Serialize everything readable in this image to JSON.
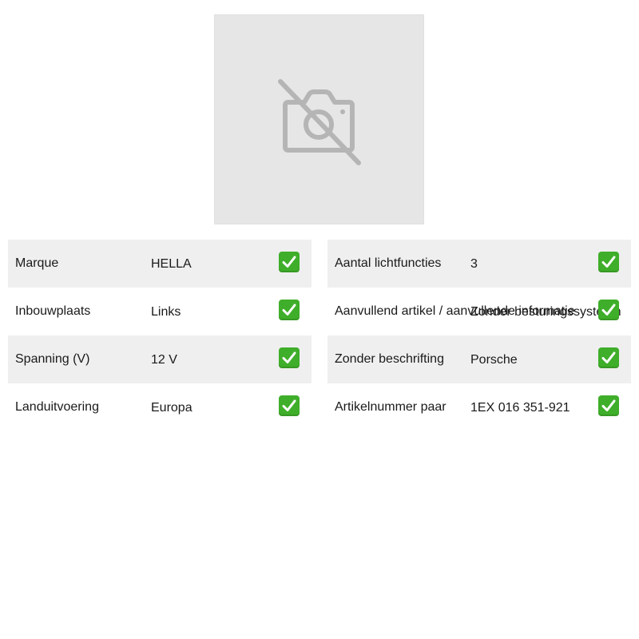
{
  "image": {
    "icon": "camera-off-icon",
    "placeholder_color": "#e6e6e6",
    "icon_color": "#b5b5b5"
  },
  "check_icon": "check-mark-icon",
  "check_color": "#3fae2a",
  "left_table": [
    {
      "label": "Marque",
      "value": "HELLA"
    },
    {
      "label": "Inbouwplaats",
      "value": "Links"
    },
    {
      "label": "Spanning (V)",
      "value": "12 V"
    },
    {
      "label": "Landuitvoering",
      "value": "Europa"
    }
  ],
  "right_table": [
    {
      "label": "Aantal lichtfuncties",
      "value": "3"
    },
    {
      "label": "Aanvullend artikel / aanvullende informatie",
      "value": "Zonder besturingssysteem"
    },
    {
      "label": "Zonder beschrifting",
      "value": "Porsche"
    },
    {
      "label": "Artikelnummer paar",
      "value": "1EX 016 351-921"
    }
  ]
}
